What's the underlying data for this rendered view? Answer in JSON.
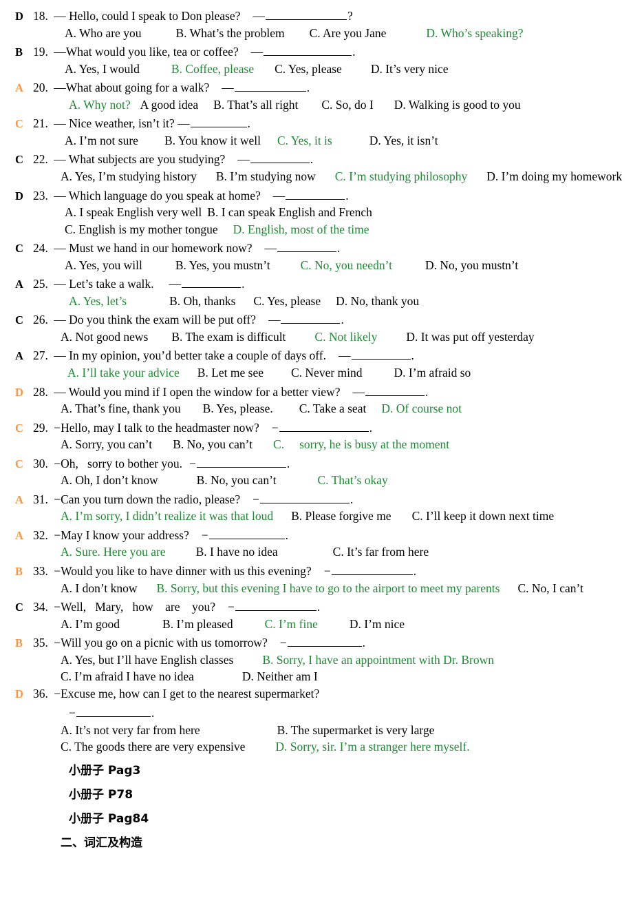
{
  "document": {
    "title": "English Dialogue Multiple-Choice Exercise (Questions 18-36)",
    "answer_key_color": "#F79646",
    "correct_option_color": "#1E8A33",
    "body_color": "#000000"
  },
  "questions": [
    {
      "marker": "D",
      "marker_color": "black",
      "number": "18.",
      "stem_pre": "— Hello, could I speak to Don please?",
      "stem_dash": "—",
      "blank_width": 118,
      "stem_post": "?",
      "option_lines": [
        {
          "indent": 46,
          "options": [
            {
              "text": "A. Who are you",
              "correct": false,
              "gap": 50
            },
            {
              "text": "B. What’s the problem",
              "correct": false,
              "gap": 36
            },
            {
              "text": "C. Are you Jane",
              "correct": false,
              "gap": 58
            },
            {
              "text": "D. Who’s speaking?",
              "correct": true,
              "gap": 0
            }
          ]
        }
      ]
    },
    {
      "marker": "B",
      "marker_color": "black",
      "number": "19.",
      "stem_pre": "—What would you like, tea or coffee?",
      "stem_dash": "—",
      "blank_width": 128,
      "stem_post": ".",
      "option_lines": [
        {
          "indent": 46,
          "options": [
            {
              "text": "A. Yes, I would",
              "correct": false,
              "gap": 46
            },
            {
              "text": "B. Coffee, please",
              "correct": true,
              "gap": 30
            },
            {
              "text": "C. Yes, please",
              "correct": false,
              "gap": 42
            },
            {
              "text": "D. It’s very nice",
              "correct": false,
              "gap": 0
            }
          ]
        }
      ]
    },
    {
      "marker": "A",
      "marker_color": "orange",
      "number": "20.",
      "stem_pre": "—What about going for a walk?",
      "stem_dash": "—",
      "blank_width": 104,
      "stem_post": ".",
      "option_lines": [
        {
          "indent": 52,
          "options": [
            {
              "text": "A. Why not?",
              "correct": true,
              "gap": 14
            },
            {
              "text": "A good idea",
              "correct": false,
              "gap": 22
            },
            {
              "text": "B. That’s all right",
              "correct": false,
              "gap": 34
            },
            {
              "text": "C. So, do I",
              "correct": false,
              "gap": 30
            },
            {
              "text": "D. Walking is good to you",
              "correct": false,
              "gap": 0
            }
          ]
        }
      ]
    },
    {
      "marker": "C",
      "marker_color": "orange",
      "number": "21.",
      "stem_pre": "— Nice weather, isn’t it? —",
      "stem_dash": "",
      "blank_width": 82,
      "stem_post": ".",
      "option_lines": [
        {
          "indent": 46,
          "options": [
            {
              "text": "A. I’m not sure",
              "correct": false,
              "gap": 38
            },
            {
              "text": "B. You know it well",
              "correct": false,
              "gap": 24
            },
            {
              "text": "C. Yes, it is",
              "correct": true,
              "gap": 54
            },
            {
              "text": "D. Yes, it isn’t",
              "correct": false,
              "gap": 0
            }
          ]
        }
      ]
    },
    {
      "marker": "C",
      "marker_color": "black",
      "number": "22.",
      "stem_pre": "— What subjects are you studying?",
      "stem_dash": "—",
      "blank_width": 86,
      "stem_post": ".",
      "option_lines": [
        {
          "indent": 40,
          "options": [
            {
              "text": "A. Yes, I’m studying history",
              "correct": false,
              "gap": 28
            },
            {
              "text": "B. I’m studying now",
              "correct": false,
              "gap": 28
            },
            {
              "text": "C. I’m studying philosophy",
              "correct": true,
              "gap": 28
            },
            {
              "text": "D. I’m doing my homework",
              "correct": false,
              "gap": 0
            }
          ]
        }
      ]
    },
    {
      "marker": "D",
      "marker_color": "black",
      "number": "23.",
      "stem_pre": "— Which language do you speak at home?",
      "stem_dash": "—",
      "blank_width": 86,
      "stem_post": ".",
      "option_lines": [
        {
          "indent": 46,
          "options": [
            {
              "text": "A. I speak English very well",
              "correct": false,
              "gap": 8
            },
            {
              "text": "B. I can speak English and French",
              "correct": false,
              "gap": 0
            }
          ]
        },
        {
          "indent": 46,
          "options": [
            {
              "text": "C. English is my mother tongue",
              "correct": false,
              "gap": 22
            },
            {
              "text": "D. English, most of the time",
              "correct": true,
              "gap": 0
            }
          ]
        }
      ]
    },
    {
      "marker": "C",
      "marker_color": "black",
      "number": "24.",
      "stem_pre": "— Must we hand in our homework now?",
      "stem_dash": "—",
      "blank_width": 86,
      "stem_post": ".",
      "option_lines": [
        {
          "indent": 46,
          "options": [
            {
              "text": "A. Yes, you will",
              "correct": false,
              "gap": 48
            },
            {
              "text": "B. Yes, you mustn’t",
              "correct": false,
              "gap": 44
            },
            {
              "text": "C. No, you needn’t",
              "correct": true,
              "gap": 48
            },
            {
              "text": "D. No, you mustn’t",
              "correct": false,
              "gap": 0
            }
          ]
        }
      ]
    },
    {
      "marker": "A",
      "marker_color": "black",
      "number": "25.",
      "stem_pre": "— Let’s take a walk.",
      "stem_dash": "—",
      "blank_width": 86,
      "stem_post": ".",
      "stem_gap": 22,
      "option_lines": [
        {
          "indent": 52,
          "options": [
            {
              "text": "A. Yes, let’s",
              "correct": true,
              "gap": 62
            },
            {
              "text": "B. Oh, thanks",
              "correct": false,
              "gap": 26
            },
            {
              "text": "C. Yes, please",
              "correct": false,
              "gap": 22
            },
            {
              "text": "D. No, thank you",
              "correct": false,
              "gap": 0
            }
          ]
        }
      ]
    },
    {
      "marker": "C",
      "marker_color": "black",
      "number": "26.",
      "stem_pre": "— Do you think the exam will be put off?",
      "stem_dash": "—",
      "blank_width": 86,
      "stem_post": ".",
      "option_lines": [
        {
          "indent": 40,
          "options": [
            {
              "text": "A. Not good news",
              "correct": false,
              "gap": 34
            },
            {
              "text": "B. The exam is difficult",
              "correct": false,
              "gap": 42
            },
            {
              "text": "C. Not likely",
              "correct": true,
              "gap": 42
            },
            {
              "text": "D. It was put off yesterday",
              "correct": false,
              "gap": 0
            }
          ]
        }
      ]
    },
    {
      "marker": "A",
      "marker_color": "black",
      "number": "27.",
      "stem_pre": "— In my opinion, you’d better take a couple of days off.",
      "stem_dash": "—",
      "blank_width": 86,
      "stem_post": ".",
      "option_lines": [
        {
          "indent": 50,
          "options": [
            {
              "text": "A. I’ll take your advice",
              "correct": true,
              "gap": 26
            },
            {
              "text": "B. Let me see",
              "correct": false,
              "gap": 40
            },
            {
              "text": "C. Never mind",
              "correct": false,
              "gap": 46
            },
            {
              "text": "D. I’m afraid so",
              "correct": false,
              "gap": 0
            }
          ]
        }
      ]
    },
    {
      "marker": "D",
      "marker_color": "orange",
      "number": "28.",
      "stem_pre": "— Would you mind if I open the window for a better view?",
      "stem_dash": "—",
      "blank_width": 86,
      "stem_post": ".",
      "option_lines": [
        {
          "indent": 40,
          "options": [
            {
              "text": "A. That’s fine, thank you",
              "correct": false,
              "gap": 32
            },
            {
              "text": "B. Yes, please.",
              "correct": false,
              "gap": 38
            },
            {
              "text": "C. Take a seat",
              "correct": false,
              "gap": 22
            },
            {
              "text": "D. Of course not",
              "correct": true,
              "gap": 0
            }
          ]
        }
      ]
    },
    {
      "marker": "C",
      "marker_color": "orange",
      "number": "29.",
      "stem_pre": "−Hello, may I talk to the headmaster now?",
      "stem_dash": "−",
      "blank_width": 130,
      "stem_post": ".",
      "option_lines": [
        {
          "indent": 40,
          "options": [
            {
              "text": "A. Sorry, you can’t",
              "correct": false,
              "gap": 30
            },
            {
              "text": "B. No, you can’t",
              "correct": false,
              "gap": 30
            },
            {
              "text": "C.",
              "correct": true,
              "gap": 22
            },
            {
              "text": "sorry, he is busy at the moment",
              "correct": true,
              "gap": 0
            }
          ]
        }
      ]
    },
    {
      "marker": "C",
      "marker_color": "orange",
      "number": "30.",
      "stem_pre": "−Oh,   sorry to bother you.",
      "stem_dash": "−",
      "blank_width": 130,
      "stem_post": ".",
      "stem_gap": 10,
      "option_lines": [
        {
          "indent": 40,
          "options": [
            {
              "text": "A. Oh, I don’t know",
              "correct": false,
              "gap": 56
            },
            {
              "text": "B. No, you can’t",
              "correct": false,
              "gap": 60
            },
            {
              "text": "C. That’s okay",
              "correct": true,
              "gap": 0
            }
          ]
        }
      ]
    },
    {
      "marker": "A",
      "marker_color": "orange",
      "number": "31.",
      "stem_pre": "−Can you turn down the radio, please?",
      "stem_dash": "−",
      "blank_width": 130,
      "stem_post": ".",
      "option_lines": [
        {
          "indent": 40,
          "options": [
            {
              "text": "A. I’m sorry, I didn’t realize it was that loud",
              "correct": true,
              "gap": 26
            },
            {
              "text": "B. Please forgive me",
              "correct": false,
              "gap": 30
            },
            {
              "text": "C. I’ll keep it down next time",
              "correct": false,
              "gap": 0
            }
          ]
        }
      ]
    },
    {
      "marker": "A",
      "marker_color": "orange",
      "number": "32.",
      "stem_pre": "−May I know your address?",
      "stem_dash": "−",
      "blank_width": 110,
      "stem_post": ".",
      "option_lines": [
        {
          "indent": 40,
          "options": [
            {
              "text": "A. Sure. Here you are",
              "correct": true,
              "gap": 44
            },
            {
              "text": "B. I have no idea",
              "correct": false,
              "gap": 80
            },
            {
              "text": "C. It’s far from here",
              "correct": false,
              "gap": 0
            }
          ]
        }
      ]
    },
    {
      "marker": "B",
      "marker_color": "orange",
      "number": "33.",
      "stem_pre": "−Would you like to have dinner with us this evening?",
      "stem_dash": "−",
      "blank_width": 118,
      "stem_post": ".",
      "option_lines": [
        {
          "indent": 40,
          "options": [
            {
              "text": "A. I don’t know",
              "correct": false,
              "gap": 28
            },
            {
              "text": "B. Sorry, but this evening I have to go to the airport to meet my parents",
              "correct": true,
              "gap": 26
            },
            {
              "text": "C. No, I can’t",
              "correct": false,
              "gap": 0
            }
          ]
        }
      ]
    },
    {
      "marker": "C",
      "marker_color": "black",
      "number": "34.",
      "stem_pre": "−Well,   Mary,   how    are    you?",
      "stem_dash": "−",
      "blank_width": 118,
      "stem_post": ".",
      "option_lines": [
        {
          "indent": 40,
          "options": [
            {
              "text": "A. I’m good",
              "correct": false,
              "gap": 62
            },
            {
              "text": "B. I’m pleased",
              "correct": false,
              "gap": 46
            },
            {
              "text": "C. I’m fine",
              "correct": true,
              "gap": 46
            },
            {
              "text": "D. I’m nice",
              "correct": false,
              "gap": 0
            }
          ]
        }
      ]
    },
    {
      "marker": "B",
      "marker_color": "orange",
      "number": "35.",
      "stem_pre": "−Will you go on a picnic with us tomorrow?",
      "stem_dash": "−",
      "blank_width": 108,
      "stem_post": ".",
      "option_lines": [
        {
          "indent": 40,
          "options": [
            {
              "text": "A. Yes, but I’ll have English classes",
              "correct": false,
              "gap": 42
            },
            {
              "text": "B. Sorry, I have an appointment with Dr. Brown",
              "correct": true,
              "gap": 0
            }
          ]
        },
        {
          "indent": 40,
          "options": [
            {
              "text": "C. I’m afraid I have no idea",
              "correct": false,
              "gap": 70
            },
            {
              "text": "D. Neither am I",
              "correct": false,
              "gap": 0
            }
          ]
        }
      ]
    },
    {
      "marker": "D",
      "marker_color": "orange",
      "number": "36.",
      "stem_pre": "−Excuse me, how can I get to the nearest supermarket?",
      "stem_dash": "",
      "blank_width": 0,
      "stem_post": "",
      "continuation": {
        "indent": 52,
        "dash": "−",
        "blank_width": 108,
        "post": "."
      },
      "option_lines": [
        {
          "indent": 40,
          "options": [
            {
              "text": "A. It’s not very far from here",
              "correct": false,
              "gap": 112
            },
            {
              "text": "B. The supermarket is very large",
              "correct": false,
              "gap": 0
            }
          ]
        },
        {
          "indent": 40,
          "options": [
            {
              "text": "C. The goods there are very expensive",
              "correct": false,
              "gap": 44
            },
            {
              "text": "D. Sorry, sir. I’m a stranger here myself.",
              "correct": true,
              "gap": 0
            }
          ]
        }
      ]
    }
  ],
  "footer_lines": [
    {
      "text": "小册子 Pag3",
      "indent": 52
    },
    {
      "text": "小册子 P78",
      "indent": 52
    },
    {
      "text": "小册子 Pag84",
      "indent": 52
    },
    {
      "text": "二、词汇及构造",
      "indent": 40
    }
  ]
}
